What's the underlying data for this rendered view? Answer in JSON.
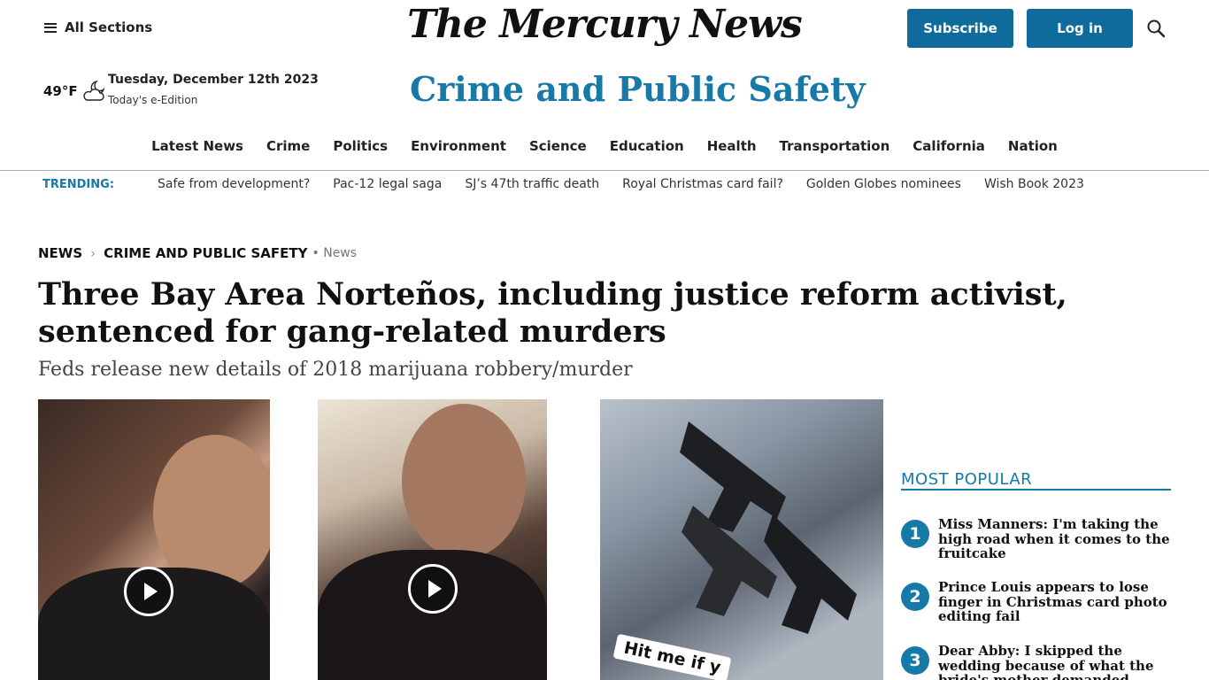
{
  "header": {
    "all_sections": "All Sections",
    "logo": "The Mercury News",
    "subscribe": "Subscribe",
    "login": "Log in"
  },
  "weather": {
    "temp": "49°F",
    "icon": "partly-cloudy-night-icon"
  },
  "date": {
    "text": "Tuesday, December 12th 2023",
    "eedition": "Today's e-Edition"
  },
  "section_title": "Crime and Public Safety",
  "nav": [
    "Latest News",
    "Crime",
    "Politics",
    "Environment",
    "Science",
    "Education",
    "Health",
    "Transportation",
    "California",
    "Nation"
  ],
  "trending": {
    "label": "TRENDING:",
    "items": [
      "Safe from development?",
      "Pac-12 legal saga",
      "SJ’s 47th traffic death",
      "Royal Christmas card fail?",
      "Golden Globes nominees",
      "Wish Book 2023"
    ]
  },
  "breadcrumb": {
    "level1": "NEWS",
    "level2": "CRIME AND PUBLIC SAFETY",
    "tag": "• News"
  },
  "article": {
    "headline": "Three Bay Area Norteños, including justice reform activist, sentenced for gang-related murders",
    "subhead": "Feds release new details of 2018 marijuana robbery/murder",
    "image_caption_overlay": "Hit me if y"
  },
  "most_popular": {
    "title": "MOST POPULAR",
    "items": [
      {
        "num": "1",
        "text": "Miss Manners: I'm taking the high road when it comes to the fruitcake"
      },
      {
        "num": "2",
        "text": "Prince Louis appears to lose finger in Christmas card photo editing fail"
      },
      {
        "num": "3",
        "text": "Dear Abby: I skipped the wedding because of what the bride's mother demanded"
      }
    ]
  },
  "colors": {
    "accent": "#1679a8",
    "button": "#0f6b9c"
  }
}
